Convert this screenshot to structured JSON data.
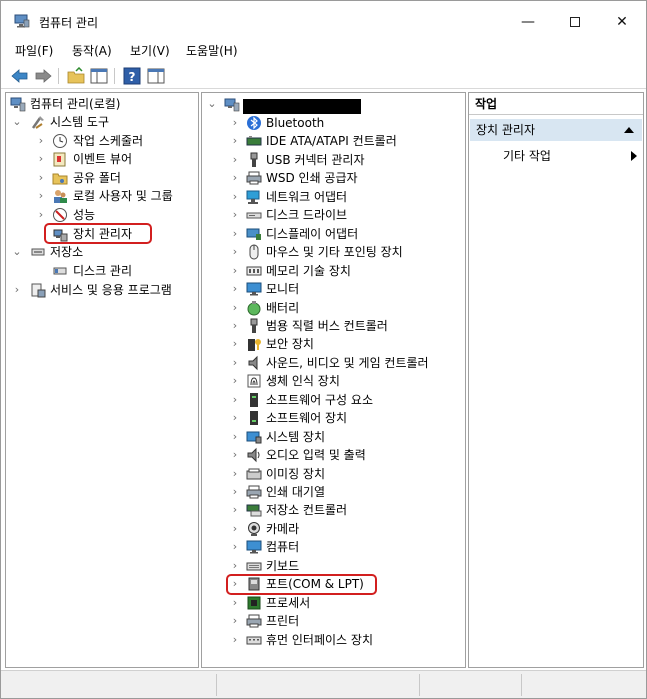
{
  "window": {
    "title": "컴퓨터 관리"
  },
  "controls": {
    "minimize": "—",
    "maximize": "",
    "close": "✕"
  },
  "menu": [
    "파일(F)",
    "동작(A)",
    "보기(V)",
    "도움말(H)"
  ],
  "left_tree": [
    {
      "label": "컴퓨터 관리(로컬)",
      "icon": "computer-management-icon",
      "chevron": ""
    },
    {
      "label": "시스템 도구",
      "icon": "tools-icon",
      "chevron": "⌄"
    },
    {
      "label": "작업 스케줄러",
      "icon": "clock-icon",
      "chevron": "›"
    },
    {
      "label": "이벤트 뷰어",
      "icon": "event-viewer-icon",
      "chevron": "›"
    },
    {
      "label": "공유 폴더",
      "icon": "shared-folder-icon",
      "chevron": "›"
    },
    {
      "label": "로컬 사용자 및 그룹",
      "icon": "users-icon",
      "chevron": "›"
    },
    {
      "label": "성능",
      "icon": "performance-icon",
      "chevron": "›"
    },
    {
      "label": "장치 관리자",
      "icon": "device-manager-icon",
      "chevron": ""
    },
    {
      "label": "저장소",
      "icon": "storage-icon",
      "chevron": "⌄"
    },
    {
      "label": "디스크 관리",
      "icon": "disk-management-icon",
      "chevron": ""
    },
    {
      "label": "서비스 및 응용 프로그램",
      "icon": "services-icon",
      "chevron": "›"
    }
  ],
  "device_tree": {
    "root_chevron": "⌄",
    "items": [
      {
        "label": "Bluetooth",
        "icon": "bluetooth-icon"
      },
      {
        "label": "IDE ATA/ATAPI 컨트롤러",
        "icon": "ide-controller-icon"
      },
      {
        "label": "USB 커넥터 관리자",
        "icon": "usb-icon"
      },
      {
        "label": "WSD 인쇄 공급자",
        "icon": "printer-icon"
      },
      {
        "label": "네트워크 어댑터",
        "icon": "network-adapter-icon"
      },
      {
        "label": "디스크 드라이브",
        "icon": "disk-drive-icon"
      },
      {
        "label": "디스플레이 어댑터",
        "icon": "display-adapter-icon"
      },
      {
        "label": "마우스 및 기타 포인팅 장치",
        "icon": "mouse-icon"
      },
      {
        "label": "메모리 기술 장치",
        "icon": "memory-icon"
      },
      {
        "label": "모니터",
        "icon": "monitor-icon"
      },
      {
        "label": "배터리",
        "icon": "battery-icon"
      },
      {
        "label": "범용 직렬 버스 컨트롤러",
        "icon": "usb-controller-icon"
      },
      {
        "label": "보안 장치",
        "icon": "security-device-icon"
      },
      {
        "label": "사운드, 비디오 및 게임 컨트롤러",
        "icon": "sound-icon"
      },
      {
        "label": "생체 인식 장치",
        "icon": "biometric-icon"
      },
      {
        "label": "소프트웨어 구성 요소",
        "icon": "software-component-icon"
      },
      {
        "label": "소프트웨어 장치",
        "icon": "software-device-icon"
      },
      {
        "label": "시스템 장치",
        "icon": "system-device-icon"
      },
      {
        "label": "오디오 입력 및 출력",
        "icon": "audio-icon"
      },
      {
        "label": "이미징 장치",
        "icon": "imaging-icon"
      },
      {
        "label": "인쇄 대기열",
        "icon": "print-queue-icon"
      },
      {
        "label": "저장소 컨트롤러",
        "icon": "storage-controller-icon"
      },
      {
        "label": "카메라",
        "icon": "camera-icon"
      },
      {
        "label": "컴퓨터",
        "icon": "computer-icon"
      },
      {
        "label": "키보드",
        "icon": "keyboard-icon"
      },
      {
        "label": "포트(COM & LPT)",
        "icon": "port-icon"
      },
      {
        "label": "프로세서",
        "icon": "processor-icon"
      },
      {
        "label": "프린터",
        "icon": "printer-icon"
      },
      {
        "label": "휴먼 인터페이스 장치",
        "icon": "hid-icon"
      }
    ]
  },
  "actions": {
    "header": "작업",
    "section": "장치 관리자",
    "item": "기타 작업"
  }
}
